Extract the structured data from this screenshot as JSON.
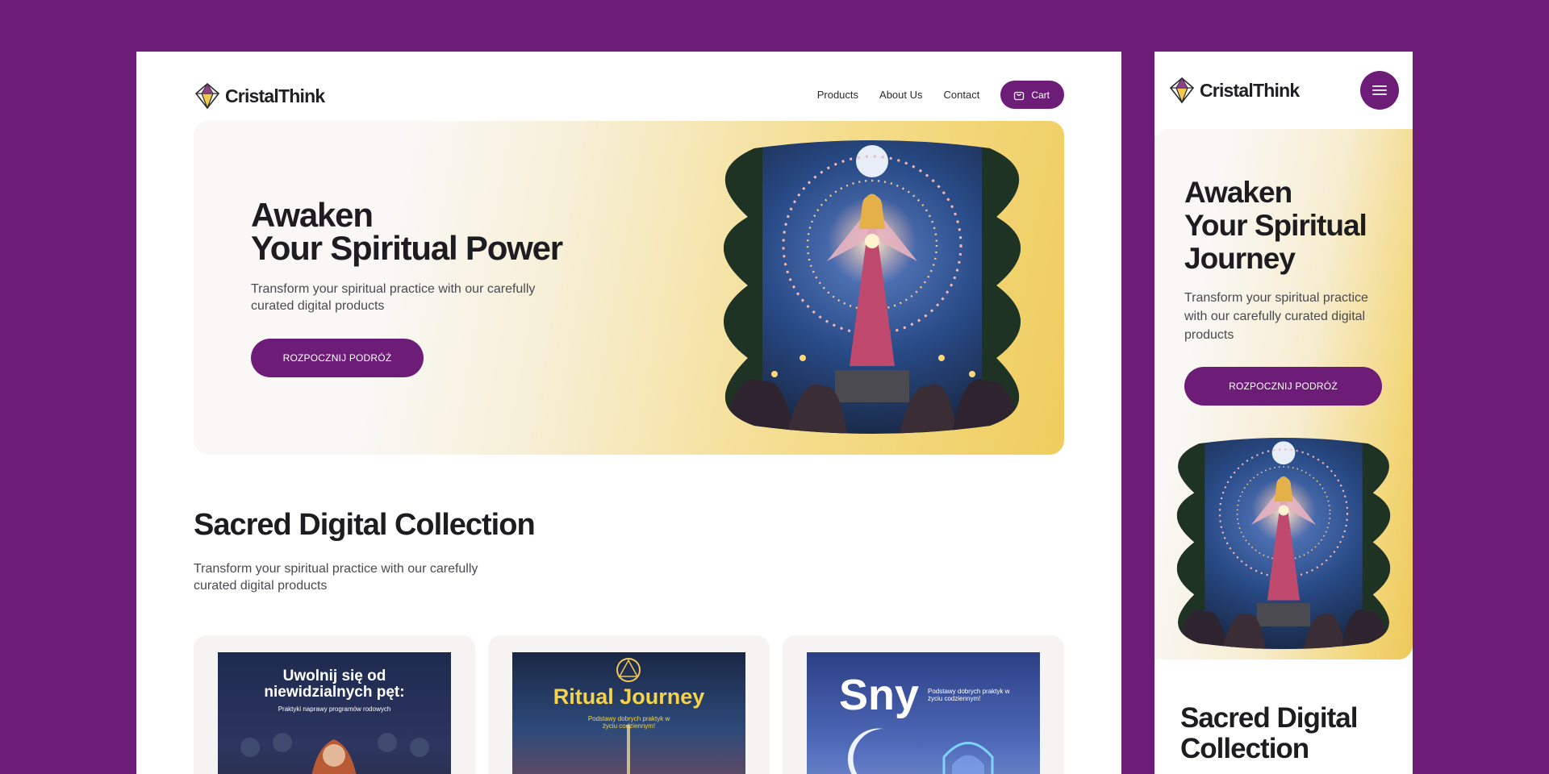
{
  "brand": {
    "name": "CristalThink",
    "icon": "crystal-diamond-icon",
    "accent": "#6d1c78",
    "gold": "#efcd5e"
  },
  "desktop": {
    "nav": {
      "links": [
        "Products",
        "About Us",
        "Contact"
      ],
      "cart_label": "Cart",
      "cart_icon": "shopping-bag-icon"
    },
    "hero": {
      "title_line1": "Awaken",
      "title_line2": "Your Spiritual Power",
      "subtitle": "Transform your spiritual practice with our carefully curated digital products",
      "cta": "ROZPOCZNIJ PODRÓŻ"
    },
    "collection": {
      "title": "Sacred Digital Collection",
      "subtitle": "Transform your spiritual practice with our carefully curated digital products",
      "cards": [
        {
          "cover_title": "Uwolnij się od niewidzialnych pęt:",
          "cover_sub": "Praktyki naprawy programów rodowych"
        },
        {
          "cover_title": "Ritual Journey",
          "cover_sub": "Podstawy dobrych praktyk w życiu codziennym!"
        },
        {
          "cover_title": "Sny",
          "cover_sub": "Podstawy dobrych praktyk w życiu codziennym!"
        }
      ]
    }
  },
  "mobile": {
    "menu_icon": "hamburger-menu-icon",
    "hero": {
      "title_line1": "Awaken",
      "title_line2": "Your Spiritual",
      "title_line3": "Journey",
      "subtitle": "Transform your spiritual practice with our carefully curated digital products",
      "cta": "ROZPOCZNIJ PODRÓŻ"
    },
    "collection_title": "Sacred Digital Collection"
  }
}
